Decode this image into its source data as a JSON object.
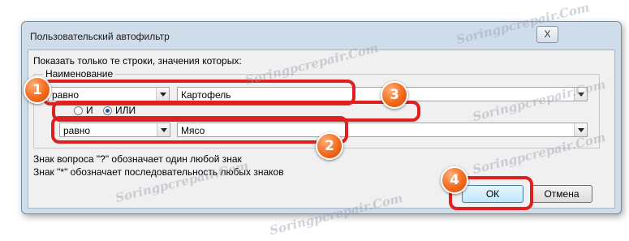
{
  "dialog": {
    "title": "Пользовательский автофильтр",
    "close_label": "X",
    "instruction": "Показать только те строки, значения которых:",
    "field_label": "Наименование",
    "condition1": {
      "operator": "равно",
      "value": "Картофель"
    },
    "logic": {
      "and_label": "И",
      "or_label": "ИЛИ",
      "selected": "ИЛИ"
    },
    "condition2": {
      "operator": "равно",
      "value": "Мясо"
    },
    "hint1": "Знак вопроса \"?\" обозначает один любой знак",
    "hint2": "Знак \"*\" обозначает последовательность любых знаков",
    "ok_label": "ОК",
    "cancel_label": "Отмена"
  },
  "annotations": {
    "badge1": "1",
    "badge2": "2",
    "badge3": "3",
    "badge4": "4",
    "highlight_color": "#e02020",
    "badge_color": "#f26a1b"
  },
  "watermark": "Soringpcrepair.Com",
  "icons": {
    "close": "close-icon",
    "dropdown": "chevron-down-icon"
  }
}
